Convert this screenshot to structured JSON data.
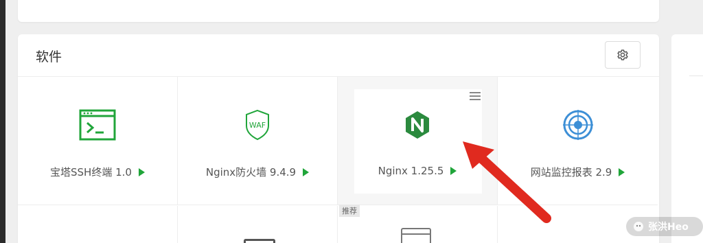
{
  "panel": {
    "title": "软件"
  },
  "apps": [
    {
      "name": "宝塔SSH终端 1.0",
      "icon": "terminal-icon"
    },
    {
      "name": "Nginx防火墙 9.4.9",
      "icon": "waf-shield-icon"
    },
    {
      "name": "Nginx 1.25.5",
      "icon": "nginx-hexagon-icon"
    },
    {
      "name": "网站监控报表 2.9",
      "icon": "monitor-target-icon"
    }
  ],
  "recommend_label": "推荐",
  "watermark": "张洪Heo",
  "colors": {
    "accent_green": "#20a53a",
    "arrow_red": "#e02a1f"
  }
}
